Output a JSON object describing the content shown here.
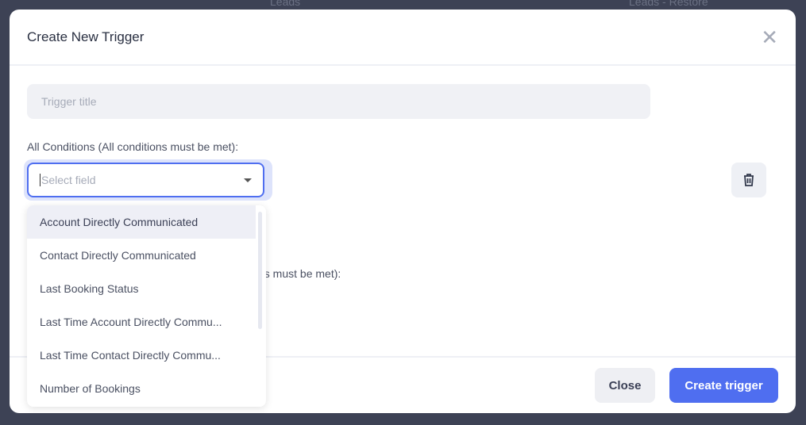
{
  "background": {
    "left_item": "Leads",
    "right_item": "Leads - Restore"
  },
  "modal": {
    "title": "Create New Trigger",
    "close_icon": "close-icon"
  },
  "form": {
    "title_placeholder": "Trigger title",
    "all_conditions_label": "All Conditions (All conditions must be met):",
    "any_conditions_label_partial": "ns must be met):",
    "select_placeholder": "Select field"
  },
  "dropdown": {
    "options": [
      "Account Directly Communicated",
      "Contact Directly Communicated",
      "Last Booking Status",
      "Last Time Account Directly Commu...",
      "Last Time Contact Directly Commu...",
      "Number of Bookings"
    ],
    "highlighted": "Account Directly Communicated"
  },
  "footer": {
    "close_label": "Close",
    "create_label": "Create trigger"
  },
  "colors": {
    "accent": "#4f6ef0",
    "overlay": "#3d4255"
  }
}
